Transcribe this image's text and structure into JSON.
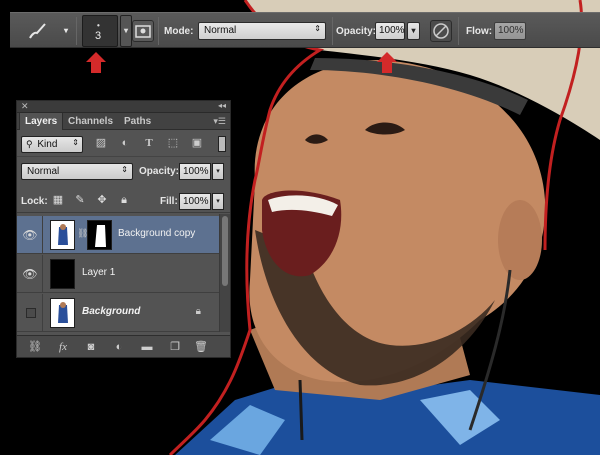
{
  "options_bar": {
    "brush_size": "3",
    "mode_label": "Mode:",
    "mode_value": "Normal",
    "opacity_label": "Opacity:",
    "opacity_value": "100%",
    "flow_label": "Flow:",
    "flow_value": "100%"
  },
  "layers_panel": {
    "tabs": [
      {
        "label": "Layers"
      },
      {
        "label": "Channels"
      },
      {
        "label": "Paths"
      }
    ],
    "filter_kind": "Kind",
    "blend_mode": "Normal",
    "opacity_label": "Opacity:",
    "opacity_value": "100%",
    "lock_label": "Lock:",
    "fill_label": "Fill:",
    "fill_value": "100%",
    "layers": [
      {
        "name": "Background copy",
        "visible": true,
        "selected": true
      },
      {
        "name": "Layer 1",
        "visible": true,
        "selected": false
      },
      {
        "name": "Background",
        "visible": false,
        "selected": false,
        "locked": true
      }
    ]
  },
  "colors": {
    "selection_outline": "#c22020",
    "annotation_arrow": "#d42a2a",
    "selected_layer": "#5d7190",
    "panel_bg": "#535353"
  }
}
